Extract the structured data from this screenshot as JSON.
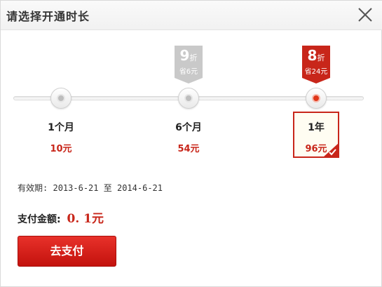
{
  "dialog": {
    "title": "请选择开通时长",
    "close_icon": "close-icon"
  },
  "options": [
    {
      "term": "1个月",
      "price": "10元",
      "selected": false
    },
    {
      "term": "6个月",
      "price": "54元",
      "selected": false,
      "badge": {
        "discount": "9",
        "unit": "折",
        "save": "省6元",
        "color": "#c9c9c9"
      }
    },
    {
      "term": "1年",
      "price": "96元",
      "selected": true,
      "badge": {
        "discount": "8",
        "unit": "折",
        "save": "省24元",
        "color": "#c8261a"
      }
    }
  ],
  "validity": {
    "label": "有效期:",
    "start": "2013-6-21",
    "separator": "至",
    "end": "2014-6-21"
  },
  "payment": {
    "label": "支付金额:",
    "amount": "0. 1元"
  },
  "pay_button": {
    "label": "去支付"
  },
  "colors": {
    "accent": "#c8261a",
    "button": "#d81e17",
    "badge_inactive": "#c9c9c9"
  }
}
